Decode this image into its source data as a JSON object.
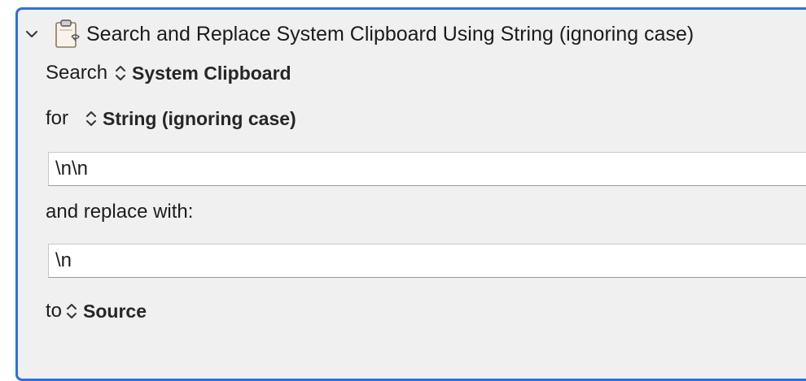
{
  "action": {
    "title": "Search and Replace System Clipboard Using String (ignoring case)"
  },
  "search": {
    "label": "Search",
    "target_value": "System Clipboard"
  },
  "for": {
    "label": "for",
    "mode_value": "String (ignoring case)"
  },
  "search_field": {
    "value": "\\n\\n"
  },
  "replace": {
    "label": "and replace with:",
    "value": "\\n"
  },
  "to": {
    "label": "to",
    "value": "Source"
  },
  "colors": {
    "selection_border": "#2f6fdc",
    "panel_bg": "#f0f0f0"
  }
}
